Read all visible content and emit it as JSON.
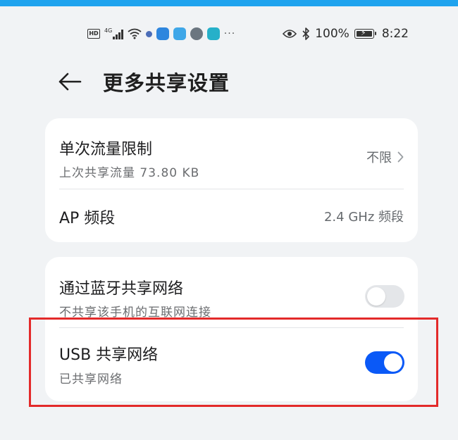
{
  "colors": {
    "accent": "#0a59f7",
    "top_bar": "#1fa3ee",
    "highlight": "#e32a2a",
    "background": "#f1f3f5"
  },
  "status_bar": {
    "network_badge": "HD",
    "network_type": "4G",
    "more": "···",
    "battery_percent": "100%",
    "time": "8:22",
    "icons": [
      "hd-icon",
      "signal-icon",
      "wifi-icon",
      "notification-dot-icon",
      "app-icon",
      "app-icon",
      "app-icon",
      "app-icon",
      "more-icon",
      "eye-icon",
      "bluetooth-icon",
      "battery-charging-icon"
    ]
  },
  "header": {
    "back_icon": "back-arrow-icon",
    "title": "更多共享设置"
  },
  "card1": {
    "traffic_limit": {
      "title": "单次流量限制",
      "subtitle": "上次共享流量 73.80 KB",
      "value": "不限",
      "icon": "chevron-right-icon"
    },
    "ap_band": {
      "title": "AP 频段",
      "value": "2.4 GHz 频段"
    }
  },
  "card2": {
    "bluetooth_sharing": {
      "title": "通过蓝牙共享网络",
      "subtitle": "不共享该手机的互联网连接",
      "enabled": false
    },
    "usb_sharing": {
      "title": "USB 共享网络",
      "subtitle": "已共享网络",
      "enabled": true
    }
  }
}
